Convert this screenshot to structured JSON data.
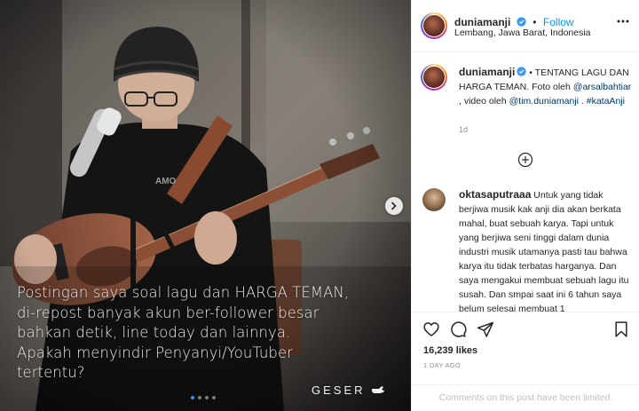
{
  "photo": {
    "caption_lines": [
      "Postingan saya soal lagu dan HARGA TEMAN,",
      "di-repost banyak akun ber-follower besar",
      "bahkan detik, line today dan lainnya.",
      "Apakah menyindir Penyanyi/YouTuber",
      "tertentu?"
    ],
    "swipe_label": "GESER",
    "carousel": {
      "total": 4,
      "active_index": 0
    }
  },
  "header": {
    "username": "duniamanji",
    "follow_label": "Follow",
    "location": "Lembang, Jawa Barat, Indonesia"
  },
  "post": {
    "author": "duniamanji",
    "text_lead": "• TENTANG LAGU DAN HARGA TEMAN. Foto oleh ",
    "mention_1": "@arsalbahtiar",
    "text_mid": " , video oleh ",
    "mention_2": "@tim.duniamanji",
    "text_sep": " . ",
    "hashtag": "#kataAnji",
    "time": "1d"
  },
  "comment": {
    "author": "oktasaputraaa",
    "text": "Untuk yang tidak berjiwa musik kak anji dia akan berkata mahal, buat sebuah karya. Tapi untuk yang berjiwa seni tinggi dalam dunia industri musik utamanya pasti tau bahwa karya itu tidak terbatas harganya. Dan saya mengakui membuat sebuah lagu itu susah. Dan smpai saat ini 6 tahun saya belum selesai membuat 1"
  },
  "actions": {
    "likes": "16,239 likes",
    "posted_ago": "1 DAY AGO",
    "comments_limited": "Comments on this post have been limited."
  },
  "colors": {
    "link": "#00376b",
    "follow": "#0095f6",
    "verified": "#3897f0",
    "muted": "#8e8e8e"
  }
}
